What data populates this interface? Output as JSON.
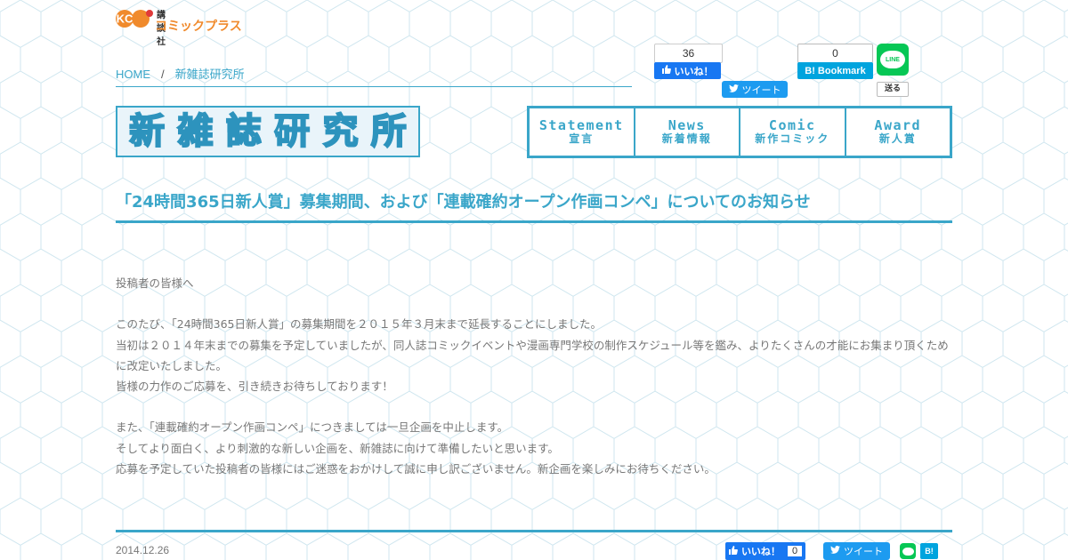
{
  "logo": {
    "kc": "KC",
    "publisher": "講談社",
    "brand": "コミックプラス"
  },
  "breadcrumb": {
    "home": "HOME",
    "separator": "/",
    "current": "新雑誌研究所"
  },
  "social_top": {
    "fb_count": "36",
    "fb_like": "いいね！",
    "tweet": "ツイート",
    "hatena_count": "0",
    "hatena_label": "Bookmark",
    "hatena_b": "B!",
    "line_label": "LINE",
    "line_send": "送る"
  },
  "site_title": [
    "新",
    "雑",
    "誌",
    "研",
    "究",
    "所"
  ],
  "nav": [
    {
      "en": "Statement",
      "ja": "宣言"
    },
    {
      "en": "News",
      "ja": "新着情報"
    },
    {
      "en": "Comic",
      "ja": "新作コミック"
    },
    {
      "en": "Award",
      "ja": "新人賞"
    }
  ],
  "article": {
    "title": "「24時間365日新人賞」募集期間、および「連載確約オープン作画コンペ」についてのお知らせ",
    "lines": {
      "l1": "投稿者の皆様へ",
      "l2": "このたび、「24時間365日新人賞」の募集期間を２０１５年３月末まで延長することにしました。",
      "l3": "当初は２０１４年末までの募集を予定していましたが、同人誌コミックイベントや漫画専門学校の制作スケジュール等を鑑み、よりたくさんの才能にお集まり頂くために改定いたしました。",
      "l4": "皆様の力作のご応募を、引き続きお待ちしております！",
      "l5": "また、「連載確約オープン作画コンペ」につきましては一旦企画を中止します。",
      "l6": "そしてより面白く、より刺激的な新しい企画を、新雑誌に向けて準備したいと思います。",
      "l7": "応募を予定していた投稿者の皆様にはご迷惑をおかけして誠に申し訳ございません。新企画を楽しみにお待ちください。"
    },
    "date": "2014.12.26"
  },
  "social_bottom": {
    "fb_like": "いいね！",
    "fb_count": "0",
    "tweet": "ツイート",
    "hatena_b": "B!"
  },
  "colors": {
    "accent": "#3aa6c9",
    "facebook": "#1877f2",
    "twitter": "#1d9bf0",
    "line": "#06c755",
    "hatena": "#00a4de",
    "logo_orange": "#f08a2c"
  }
}
